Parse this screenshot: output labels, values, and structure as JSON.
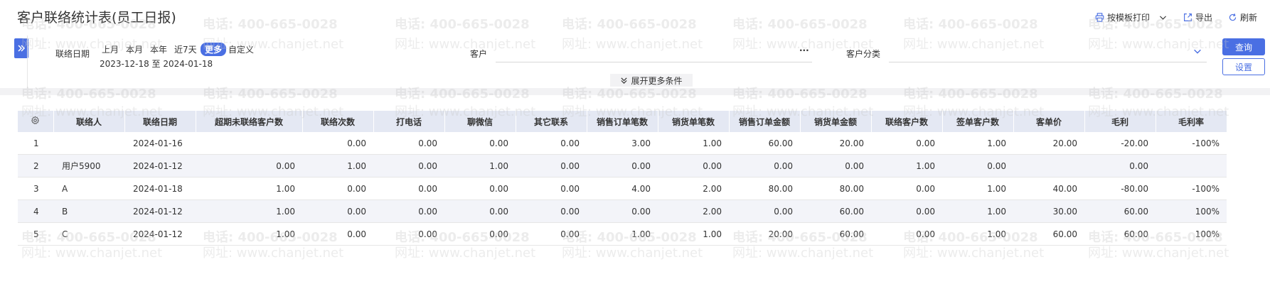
{
  "header": {
    "title": "客户联络统计表(员工日报)",
    "actions": {
      "print": "按模板打印",
      "export": "导出",
      "refresh": "刷新"
    }
  },
  "filters": {
    "date_label": "联络日期",
    "date_options": [
      "上月",
      "本月",
      "本年",
      "近7天",
      "更多",
      "自定义"
    ],
    "active_option": "更多",
    "date_range": "2023-12-18 至 2024-01-18",
    "customer_label": "客户",
    "customer_value": "",
    "customer_ellipsis": "···",
    "category_label": "客户分类",
    "category_value": "",
    "more_conditions": "展开更多条件",
    "query_button": "查询",
    "settings_button": "设置"
  },
  "table": {
    "columns": [
      "联络人",
      "联络日期",
      "超期未联络客户数",
      "联络次数",
      "打电话",
      "聊微信",
      "其它联系",
      "销售订单笔数",
      "销货单笔数",
      "销售订单金额",
      "销货单金额",
      "联络客户数",
      "签单客户数",
      "客单价",
      "毛利",
      "毛利率"
    ],
    "rows": [
      {
        "idx": "1",
        "name": "",
        "date": "2024-01-16",
        "overdue": "",
        "contacts": "0.00",
        "calls": "0.00",
        "wechat": "0.00",
        "other": "0.00",
        "so_count": "3.00",
        "sd_count": "1.00",
        "so_amount": "60.00",
        "sd_amount": "20.00",
        "contact_cust": "0.00",
        "signed_cust": "1.00",
        "unit_price": "20.00",
        "profit": "-20.00",
        "profit_rate": "-100%"
      },
      {
        "idx": "2",
        "name": "用户5900",
        "date": "2024-01-12",
        "overdue": "0.00",
        "contacts": "1.00",
        "calls": "0.00",
        "wechat": "1.00",
        "other": "0.00",
        "so_count": "0.00",
        "sd_count": "0.00",
        "so_amount": "0.00",
        "sd_amount": "0.00",
        "contact_cust": "1.00",
        "signed_cust": "0.00",
        "unit_price": "",
        "profit": "0.00",
        "profit_rate": ""
      },
      {
        "idx": "3",
        "name": "A",
        "date": "2024-01-18",
        "overdue": "1.00",
        "contacts": "0.00",
        "calls": "0.00",
        "wechat": "0.00",
        "other": "0.00",
        "so_count": "4.00",
        "sd_count": "2.00",
        "so_amount": "80.00",
        "sd_amount": "80.00",
        "contact_cust": "0.00",
        "signed_cust": "1.00",
        "unit_price": "40.00",
        "profit": "-80.00",
        "profit_rate": "-100%"
      },
      {
        "idx": "4",
        "name": "B",
        "date": "2024-01-12",
        "overdue": "1.00",
        "contacts": "0.00",
        "calls": "0.00",
        "wechat": "0.00",
        "other": "0.00",
        "so_count": "0.00",
        "sd_count": "2.00",
        "so_amount": "0.00",
        "sd_amount": "60.00",
        "contact_cust": "0.00",
        "signed_cust": "1.00",
        "unit_price": "30.00",
        "profit": "60.00",
        "profit_rate": "100%"
      },
      {
        "idx": "5",
        "name": "C",
        "date": "2024-01-12",
        "overdue": "1.00",
        "contacts": "0.00",
        "calls": "0.00",
        "wechat": "0.00",
        "other": "0.00",
        "so_count": "1.00",
        "sd_count": "1.00",
        "so_amount": "20.00",
        "sd_amount": "60.00",
        "contact_cust": "0.00",
        "signed_cust": "1.00",
        "unit_price": "60.00",
        "profit": "60.00",
        "profit_rate": "100%"
      }
    ]
  },
  "watermark": {
    "phone": "电话: 400-665-0028",
    "site": "网址: www.chanjet.net"
  },
  "colors": {
    "accent": "#4a6fe3",
    "negative": "#e02020",
    "header_bg": "#e4e8f3"
  }
}
